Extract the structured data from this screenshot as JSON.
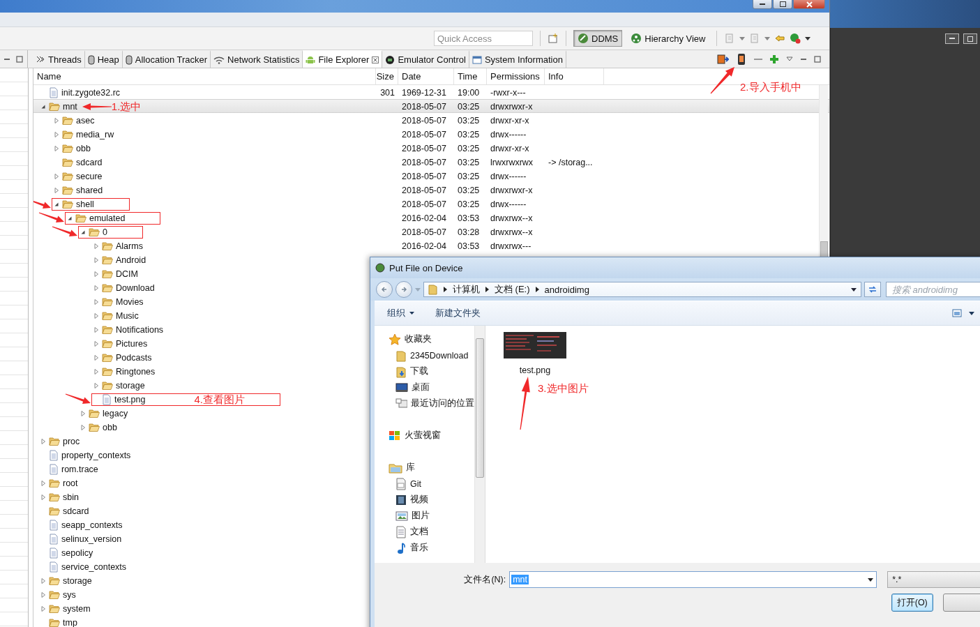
{
  "toolbar": {
    "quick_access": {
      "placeholder": "Quick Access"
    },
    "perspectives": [
      {
        "label": "DDMS",
        "selected": true
      },
      {
        "label": "Hierarchy View",
        "selected": false
      }
    ]
  },
  "tabs": [
    {
      "label": "Threads",
      "selected": false,
      "kind": "threads"
    },
    {
      "label": "Heap",
      "selected": false,
      "kind": "heap"
    },
    {
      "label": "Allocation Tracker",
      "selected": false,
      "kind": "heap"
    },
    {
      "label": "Network Statistics",
      "selected": false,
      "kind": "network"
    },
    {
      "label": "File Explorer",
      "selected": true,
      "kind": "android"
    },
    {
      "label": "Emulator Control",
      "selected": false,
      "kind": "emulator"
    },
    {
      "label": "System Information",
      "selected": false,
      "kind": "window"
    }
  ],
  "view_note": "2.导入手机中",
  "table": {
    "columns": [
      "Name",
      "Size",
      "Date",
      "Time",
      "Permissions",
      "Info"
    ],
    "rows": [
      {
        "name": "init.zygote32.rc",
        "kind": "file",
        "selected": false,
        "boxed": false,
        "size": "301",
        "date": "1969-12-31",
        "time": "19:00",
        "permissions": "-rwxr-x---"
      },
      {
        "name": "mnt",
        "kind": "folder",
        "expanded": true,
        "selected": true,
        "boxed": false,
        "note": "1.选中",
        "date": "2018-05-07",
        "time": "03:25",
        "permissions": "drwxrwxr-x",
        "children": [
          {
            "name": "asec",
            "kind": "folder",
            "expanded": false,
            "selected": false,
            "boxed": false,
            "date": "2018-05-07",
            "time": "03:25",
            "permissions": "drwxr-xr-x"
          },
          {
            "name": "media_rw",
            "kind": "folder",
            "expanded": false,
            "selected": false,
            "boxed": false,
            "date": "2018-05-07",
            "time": "03:25",
            "permissions": "drwx------"
          },
          {
            "name": "obb",
            "kind": "folder",
            "expanded": false,
            "selected": false,
            "boxed": false,
            "date": "2018-05-07",
            "time": "03:25",
            "permissions": "drwxr-xr-x"
          },
          {
            "name": "sdcard",
            "kind": "folder",
            "selected": false,
            "boxed": false,
            "date": "2018-05-07",
            "time": "03:25",
            "permissions": "lrwxrwxrwx",
            "info": "-> /storag..."
          },
          {
            "name": "secure",
            "kind": "folder",
            "expanded": false,
            "selected": false,
            "boxed": false,
            "date": "2018-05-07",
            "time": "03:25",
            "permissions": "drwx------"
          },
          {
            "name": "shared",
            "kind": "folder",
            "expanded": false,
            "selected": false,
            "boxed": false,
            "date": "2018-05-07",
            "time": "03:25",
            "permissions": "drwxrwxr-x"
          },
          {
            "name": "shell",
            "kind": "folder",
            "expanded": true,
            "selected": false,
            "boxed": true,
            "date": "2018-05-07",
            "time": "03:25",
            "permissions": "drwx------",
            "children": [
              {
                "name": "emulated",
                "kind": "folder",
                "expanded": true,
                "selected": false,
                "boxed": true,
                "date": "2016-02-04",
                "time": "03:53",
                "permissions": "drwxrwx--x",
                "children": [
                  {
                    "name": "0",
                    "kind": "folder",
                    "expanded": true,
                    "selected": false,
                    "boxed": true,
                    "date": "2018-05-07",
                    "time": "03:28",
                    "permissions": "drwxrwx--x",
                    "children": [
                      {
                        "name": "Alarms",
                        "kind": "folder",
                        "expanded": false,
                        "selected": false,
                        "boxed": false,
                        "date": "2016-02-04",
                        "time": "03:53",
                        "permissions": "drwxrwx---"
                      },
                      {
                        "name": "Android",
                        "kind": "folder",
                        "expanded": false,
                        "selected": false,
                        "boxed": false
                      },
                      {
                        "name": "DCIM",
                        "kind": "folder",
                        "expanded": false,
                        "selected": false,
                        "boxed": false
                      },
                      {
                        "name": "Download",
                        "kind": "folder",
                        "expanded": false,
                        "selected": false,
                        "boxed": false
                      },
                      {
                        "name": "Movies",
                        "kind": "folder",
                        "expanded": false,
                        "selected": false,
                        "boxed": false
                      },
                      {
                        "name": "Music",
                        "kind": "folder",
                        "expanded": false,
                        "selected": false,
                        "boxed": false
                      },
                      {
                        "name": "Notifications",
                        "kind": "folder",
                        "expanded": false,
                        "selected": false,
                        "boxed": false
                      },
                      {
                        "name": "Pictures",
                        "kind": "folder",
                        "expanded": false,
                        "selected": false,
                        "boxed": false
                      },
                      {
                        "name": "Podcasts",
                        "kind": "folder",
                        "expanded": false,
                        "selected": false,
                        "boxed": false
                      },
                      {
                        "name": "Ringtones",
                        "kind": "folder",
                        "expanded": false,
                        "selected": false,
                        "boxed": false
                      },
                      {
                        "name": "storage",
                        "kind": "folder",
                        "expanded": false,
                        "selected": false,
                        "boxed": false
                      },
                      {
                        "name": "test.png",
                        "kind": "file",
                        "selected": false,
                        "boxed": true,
                        "note": "4.查看图片"
                      }
                    ]
                  },
                  {
                    "name": "legacy",
                    "kind": "folder",
                    "expanded": false,
                    "selected": false,
                    "boxed": false
                  },
                  {
                    "name": "obb",
                    "kind": "folder",
                    "expanded": false,
                    "selected": false,
                    "boxed": false
                  }
                ]
              }
            ]
          }
        ]
      },
      {
        "name": "proc",
        "kind": "folder",
        "expanded": false,
        "selected": false,
        "boxed": false
      },
      {
        "name": "property_contexts",
        "kind": "file",
        "selected": false,
        "boxed": false
      },
      {
        "name": "rom.trace",
        "kind": "file",
        "selected": false,
        "boxed": false
      },
      {
        "name": "root",
        "kind": "folder",
        "expanded": false,
        "selected": false,
        "boxed": false
      },
      {
        "name": "sbin",
        "kind": "folder",
        "expanded": false,
        "selected": false,
        "boxed": false
      },
      {
        "name": "sdcard",
        "kind": "folder",
        "selected": false,
        "boxed": false
      },
      {
        "name": "seapp_contexts",
        "kind": "file",
        "selected": false,
        "boxed": false
      },
      {
        "name": "selinux_version",
        "kind": "file",
        "selected": false,
        "boxed": false
      },
      {
        "name": "sepolicy",
        "kind": "file",
        "selected": false,
        "boxed": false
      },
      {
        "name": "service_contexts",
        "kind": "file",
        "selected": false,
        "boxed": false
      },
      {
        "name": "storage",
        "kind": "folder",
        "expanded": false,
        "selected": false,
        "boxed": false
      },
      {
        "name": "sys",
        "kind": "folder",
        "expanded": false,
        "selected": false,
        "boxed": false
      },
      {
        "name": "system",
        "kind": "folder",
        "expanded": false,
        "selected": false,
        "boxed": false
      },
      {
        "name": "tmp",
        "kind": "folder",
        "selected": false,
        "boxed": false
      }
    ]
  },
  "dialog": {
    "title": "Put File on Device",
    "path": [
      "计算机",
      "文档 (E:)",
      "androidimg"
    ],
    "search": {
      "placeholder": "搜索 androidimg"
    },
    "commands": [
      {
        "label": "组织",
        "menu": true
      },
      {
        "label": "新建文件夹",
        "menu": false
      }
    ],
    "nav": [
      {
        "label": "收藏夹",
        "kind": "favorites",
        "children": [
          {
            "label": "2345Download",
            "kind": "folder"
          },
          {
            "label": "下载",
            "kind": "download"
          },
          {
            "label": "桌面",
            "kind": "desktop"
          },
          {
            "label": "最近访问的位置",
            "kind": "recent"
          }
        ]
      },
      {
        "label": "火萤视窗",
        "kind": "windows"
      },
      {
        "label": "库",
        "kind": "library",
        "children": [
          {
            "label": "Git",
            "kind": "git"
          },
          {
            "label": "视频",
            "kind": "video"
          },
          {
            "label": "图片",
            "kind": "pictures"
          },
          {
            "label": "文档",
            "kind": "documents"
          },
          {
            "label": "音乐",
            "kind": "music"
          }
        ]
      }
    ],
    "files": [
      {
        "name": "test.png",
        "kind": "picture",
        "selected": false,
        "note": "3.选中图片"
      }
    ],
    "filename": {
      "label": "文件名(N):",
      "value": "mnt"
    },
    "filter": {
      "value": "*.*"
    },
    "buttons": [
      {
        "label": "打开(O)",
        "default": true
      },
      {
        "default": false
      }
    ]
  }
}
